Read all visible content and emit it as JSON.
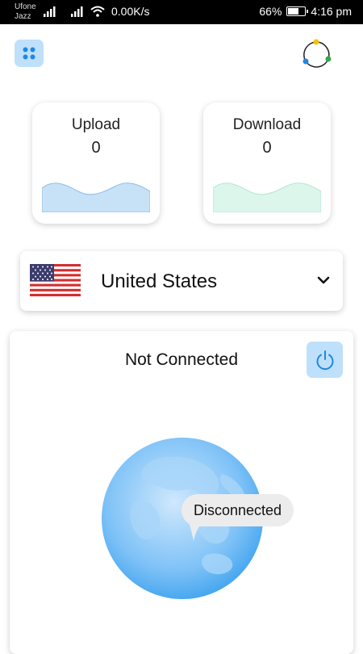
{
  "statusbar": {
    "carrier_line1": "Ufone",
    "carrier_line2": "Jazz",
    "net_speed": "0.00K/s",
    "battery_percent": "66%",
    "battery_level": 0.66,
    "time": "4:16 pm",
    "icons": [
      "signal-icon",
      "signal-icon",
      "wifi-icon",
      "battery-icon"
    ]
  },
  "header": {
    "menu_icon": "grid-dots-icon",
    "logo_icon": "app-logo-icon"
  },
  "stats": {
    "upload": {
      "label": "Upload",
      "value": "0"
    },
    "download": {
      "label": "Download",
      "value": "0"
    }
  },
  "server": {
    "country": "United States",
    "flag_icon": "us-flag-icon",
    "dropdown_icon": "chevron-down-icon"
  },
  "connection": {
    "title": "Not Connected",
    "power_icon": "power-icon",
    "bubble": "Disconnected"
  },
  "colors": {
    "accent": "#1e88e5",
    "button_bg": "#bfe0fb",
    "upload_wave": "#c7e1f7",
    "download_wave": "#dcf6ec",
    "globe": "#64b5f6"
  }
}
